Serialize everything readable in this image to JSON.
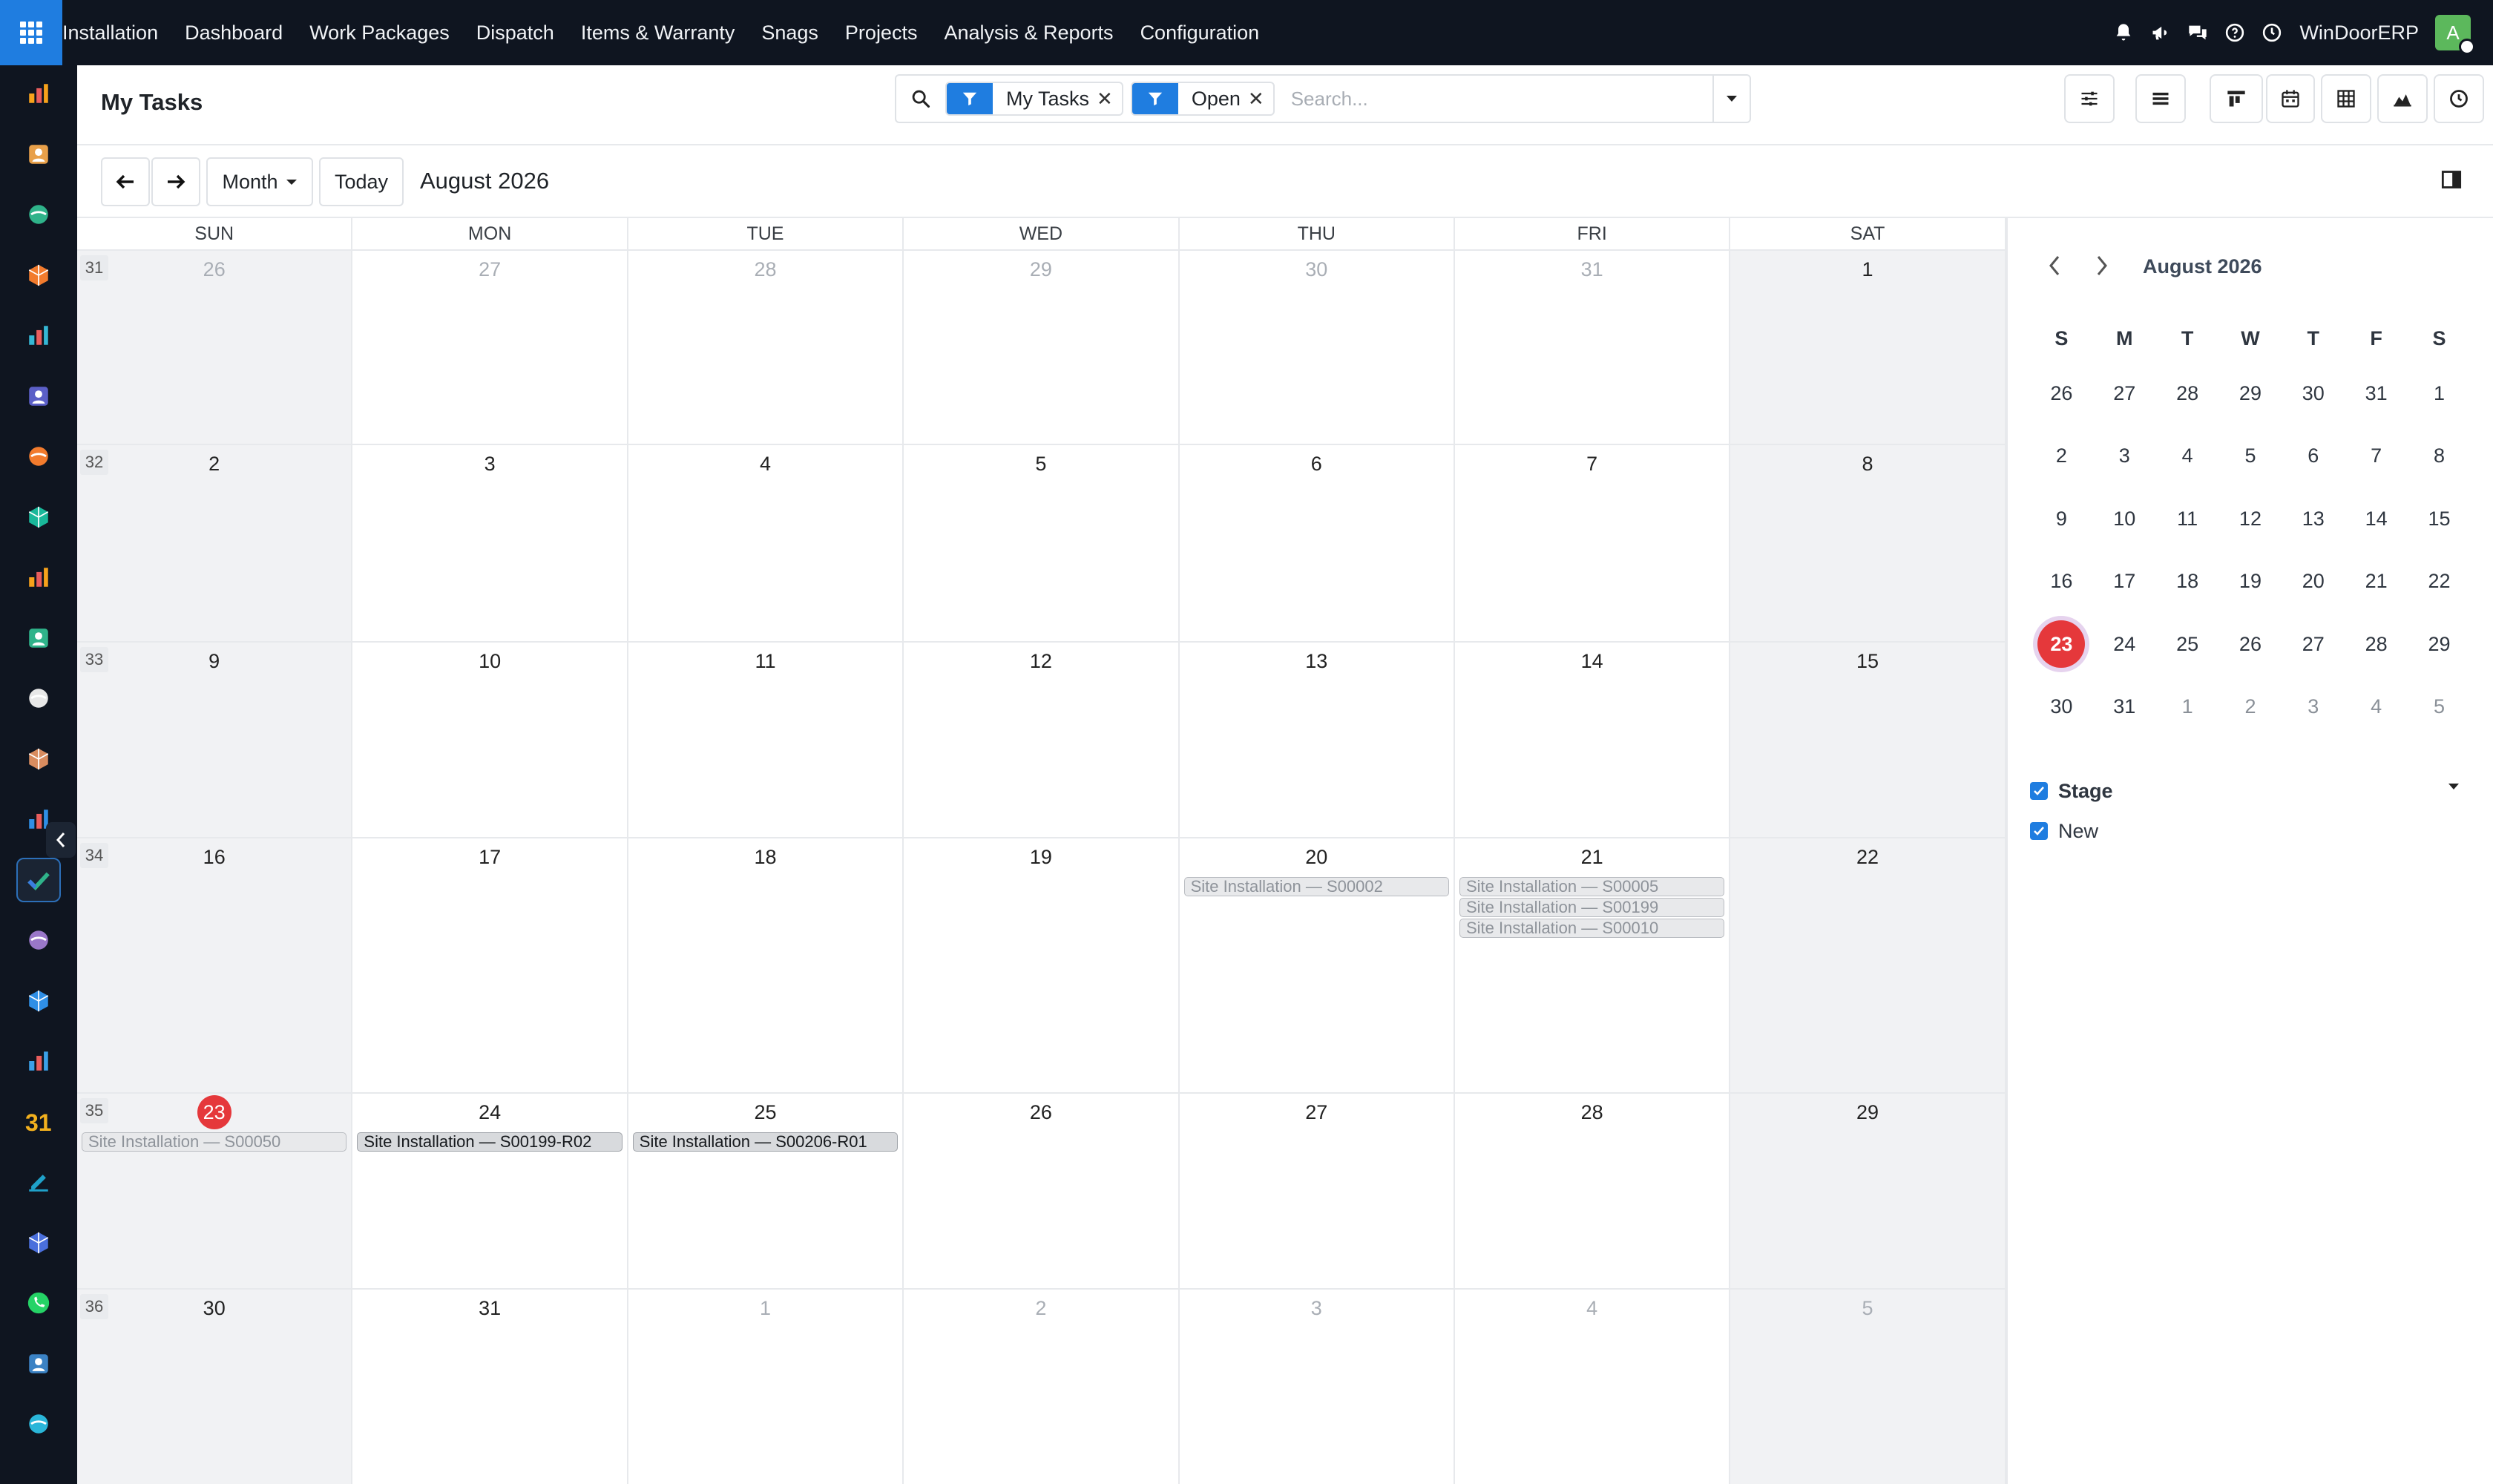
{
  "topbar": {
    "menu": [
      "Installation",
      "Dashboard",
      "Work Packages",
      "Dispatch",
      "Items & Warranty",
      "Snags",
      "Projects",
      "Analysis & Reports",
      "Configuration"
    ],
    "company": "WinDoorERP",
    "avatar_initial": "A",
    "icons": [
      "bell-icon",
      "megaphone-icon",
      "chat-icon",
      "help-icon",
      "clock-icon"
    ]
  },
  "rail": {
    "apps": [
      "stock-app",
      "inventory-app",
      "contacts-app",
      "discuss-app",
      "website-app",
      "email-marketing-app",
      "livechat-app",
      "purchase-app",
      "sales-app",
      "employees-app",
      "product-app",
      "inventory-2-app",
      "project-app",
      "knowledge-app",
      "packaging-app",
      "invoicing-app",
      "team-app",
      "calendar-app",
      "sign-app",
      "dashboards-app",
      "whatsapp-app",
      "timesheet-app",
      "website-2-app"
    ],
    "active_index": 13
  },
  "control": {
    "title": "My Tasks",
    "facets": [
      {
        "label": "My Tasks"
      },
      {
        "label": "Open"
      }
    ],
    "search_placeholder": "Search..."
  },
  "toolbar": {
    "prev": "←",
    "next": "→",
    "scale": "Month",
    "today": "Today",
    "title": "August 2026"
  },
  "calendar": {
    "dow": [
      "SUN",
      "MON",
      "TUE",
      "WED",
      "THU",
      "FRI",
      "SAT"
    ],
    "weeks": [
      {
        "num": "31",
        "days": [
          {
            "d": "26",
            "muted": true
          },
          {
            "d": "27",
            "muted": true
          },
          {
            "d": "28",
            "muted": true
          },
          {
            "d": "29",
            "muted": true
          },
          {
            "d": "30",
            "muted": true
          },
          {
            "d": "31",
            "muted": true
          },
          {
            "d": "1"
          }
        ]
      },
      {
        "num": "32",
        "days": [
          {
            "d": "2"
          },
          {
            "d": "3"
          },
          {
            "d": "4"
          },
          {
            "d": "5"
          },
          {
            "d": "6"
          },
          {
            "d": "7"
          },
          {
            "d": "8"
          }
        ]
      },
      {
        "num": "33",
        "days": [
          {
            "d": "9"
          },
          {
            "d": "10"
          },
          {
            "d": "11"
          },
          {
            "d": "12"
          },
          {
            "d": "13"
          },
          {
            "d": "14"
          },
          {
            "d": "15"
          }
        ]
      },
      {
        "num": "34",
        "days": [
          {
            "d": "16"
          },
          {
            "d": "17"
          },
          {
            "d": "18"
          },
          {
            "d": "19"
          },
          {
            "d": "20",
            "events": [
              {
                "label": "Site Installation — S00002",
                "style": "faded"
              }
            ]
          },
          {
            "d": "21",
            "events": [
              {
                "label": "Site Installation — S00005",
                "style": "faded"
              },
              {
                "label": "Site Installation — S00199",
                "style": "faded"
              },
              {
                "label": "Site Installation — S00010",
                "style": "faded"
              }
            ]
          },
          {
            "d": "22"
          }
        ]
      },
      {
        "num": "35",
        "days": [
          {
            "d": "23",
            "today": true,
            "events": [
              {
                "label": "Site Installation — S00050",
                "style": "faded"
              }
            ]
          },
          {
            "d": "24",
            "events": [
              {
                "label": "Site Installation — S00199-R02",
                "style": "solid"
              }
            ]
          },
          {
            "d": "25",
            "events": [
              {
                "label": "Site Installation — S00206-R01",
                "style": "solid"
              }
            ]
          },
          {
            "d": "26"
          },
          {
            "d": "27"
          },
          {
            "d": "28"
          },
          {
            "d": "29"
          }
        ]
      },
      {
        "num": "36",
        "days": [
          {
            "d": "30"
          },
          {
            "d": "31"
          },
          {
            "d": "1",
            "muted": true
          },
          {
            "d": "2",
            "muted": true
          },
          {
            "d": "3",
            "muted": true
          },
          {
            "d": "4",
            "muted": true
          },
          {
            "d": "5",
            "muted": true
          }
        ]
      }
    ]
  },
  "mini_calendar": {
    "title": "August 2026",
    "dow": [
      "S",
      "M",
      "T",
      "W",
      "T",
      "F",
      "S"
    ],
    "rows": [
      [
        {
          "d": "26"
        },
        {
          "d": "27"
        },
        {
          "d": "28"
        },
        {
          "d": "29"
        },
        {
          "d": "30"
        },
        {
          "d": "31"
        },
        {
          "d": "1"
        }
      ],
      [
        {
          "d": "2"
        },
        {
          "d": "3"
        },
        {
          "d": "4"
        },
        {
          "d": "5"
        },
        {
          "d": "6"
        },
        {
          "d": "7"
        },
        {
          "d": "8"
        }
      ],
      [
        {
          "d": "9"
        },
        {
          "d": "10"
        },
        {
          "d": "11"
        },
        {
          "d": "12"
        },
        {
          "d": "13"
        },
        {
          "d": "14"
        },
        {
          "d": "15"
        }
      ],
      [
        {
          "d": "16"
        },
        {
          "d": "17"
        },
        {
          "d": "18"
        },
        {
          "d": "19"
        },
        {
          "d": "20"
        },
        {
          "d": "21"
        },
        {
          "d": "22"
        }
      ],
      [
        {
          "d": "23",
          "today": true
        },
        {
          "d": "24"
        },
        {
          "d": "25"
        },
        {
          "d": "26"
        },
        {
          "d": "27"
        },
        {
          "d": "28"
        },
        {
          "d": "29"
        }
      ],
      [
        {
          "d": "30"
        },
        {
          "d": "31"
        },
        {
          "d": "1",
          "muted": true
        },
        {
          "d": "2",
          "muted": true
        },
        {
          "d": "3",
          "muted": true
        },
        {
          "d": "4",
          "muted": true
        },
        {
          "d": "5",
          "muted": true
        }
      ]
    ]
  },
  "filters": {
    "group_label": "Stage",
    "items": [
      "New"
    ]
  },
  "colors": {
    "accent": "#1f7de0",
    "today": "#e5383b",
    "topbar": "#0f1520"
  }
}
